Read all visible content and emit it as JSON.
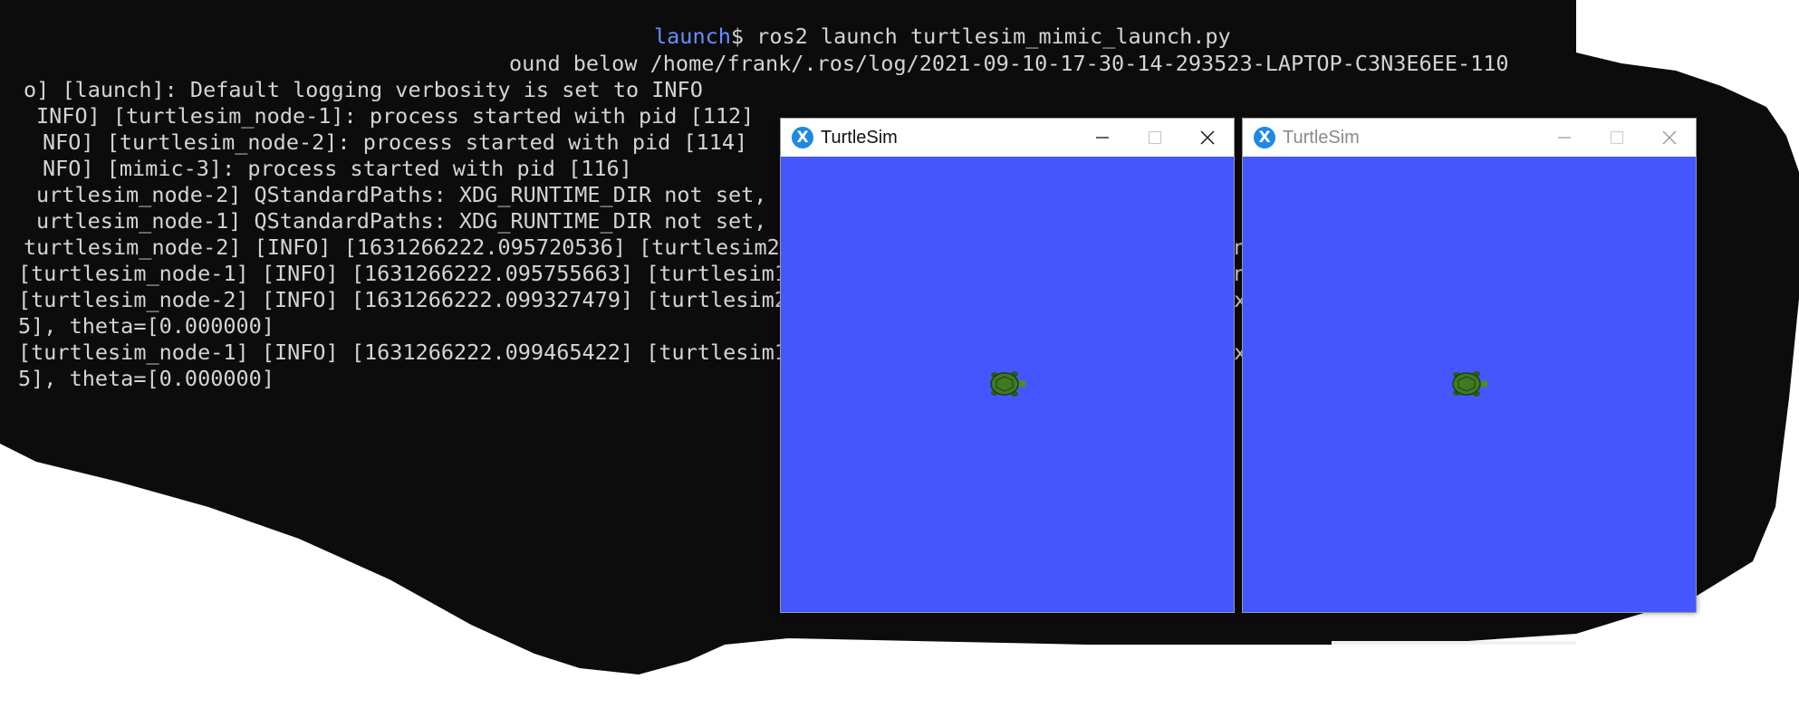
{
  "colors": {
    "terminal_bg": "#0c0c0c",
    "terminal_text": "#d4d4d4",
    "prompt_path": "#6b8cff",
    "sim_background": "#4556ff",
    "turtle_shell": "#3f7a22"
  },
  "terminal": {
    "prompt_path": "launch",
    "prompt_command": "$ ros2 launch turtlesim_mimic_launch.py",
    "lines": [
      "ound below /home/frank/.ros/log/2021-09-10-17-30-14-293523-LAPTOP-C3N3E6EE-110",
      "o] [launch]: Default logging verbosity is set to INFO",
      "INFO] [turtlesim_node-1]: process started with pid [112]",
      "NFO] [turtlesim_node-2]: process started with pid [114]",
      "NFO] [mimic-3]: process started with pid [116]",
      "urtlesim_node-2] QStandardPaths: XDG_RUNTIME_DIR not set,",
      "urtlesim_node-1] QStandardPaths: XDG_RUNTIME_DIR not set,",
      "turtlesim_node-2] [INFO] [1631266222.095720536] [turtlesim2",
      "[turtlesim_node-1] [INFO] [1631266222.095755663] [turtlesim1",
      "[turtlesim_node-2] [INFO] [1631266222.099327479] [turtlesim2",
      "5], theta=[0.000000]",
      "[turtlesim_node-1] [INFO] [1631266222.099465422] [turtlesim1",
      "5], theta=[0.000000]"
    ],
    "between_windows_fragments": [
      "n",
      "n",
      "x",
      "x"
    ]
  },
  "windows": [
    {
      "title": "TurtleSim",
      "app_icon": "X",
      "state": "active",
      "icons": [
        "minimize-icon",
        "maximize-icon",
        "close-icon"
      ]
    },
    {
      "title": "TurtleSim",
      "app_icon": "X",
      "state": "inactive",
      "icons": [
        "minimize-icon",
        "maximize-icon",
        "close-icon"
      ]
    }
  ]
}
